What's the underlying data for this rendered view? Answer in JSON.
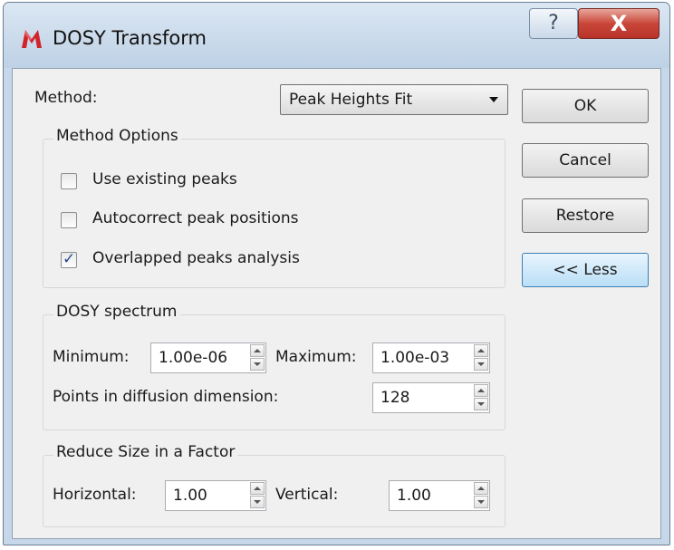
{
  "window": {
    "title": "DOSY Transform",
    "app_icon": "mnova-m-icon",
    "help_glyph": "?",
    "close_glyph": "X"
  },
  "method": {
    "label": "Method:",
    "selected": "Peak Heights Fit"
  },
  "method_options": {
    "title": "Method Options",
    "checkboxes": [
      {
        "label": "Use existing peaks",
        "checked": false
      },
      {
        "label": "Autocorrect peak positions",
        "checked": false
      },
      {
        "label": "Overlapped peaks analysis",
        "checked": true
      }
    ]
  },
  "dosy_spectrum": {
    "title": "DOSY spectrum",
    "minimum_label": "Minimum:",
    "minimum_value": "1.00e-06",
    "maximum_label": "Maximum:",
    "maximum_value": "1.00e-03",
    "points_label": "Points in diffusion dimension:",
    "points_value": "128"
  },
  "reduce_size": {
    "title": "Reduce Size in a Factor",
    "horizontal_label": "Horizontal:",
    "horizontal_value": "1.00",
    "vertical_label": "Vertical:",
    "vertical_value": "1.00"
  },
  "buttons": {
    "ok": "OK",
    "cancel": "Cancel",
    "restore": "Restore",
    "less": "<< Less"
  },
  "colors": {
    "frame": "#c6d7e9",
    "client_bg": "#f0f0f0",
    "close_red": "#c9473a",
    "active_button": "#b9def6"
  }
}
